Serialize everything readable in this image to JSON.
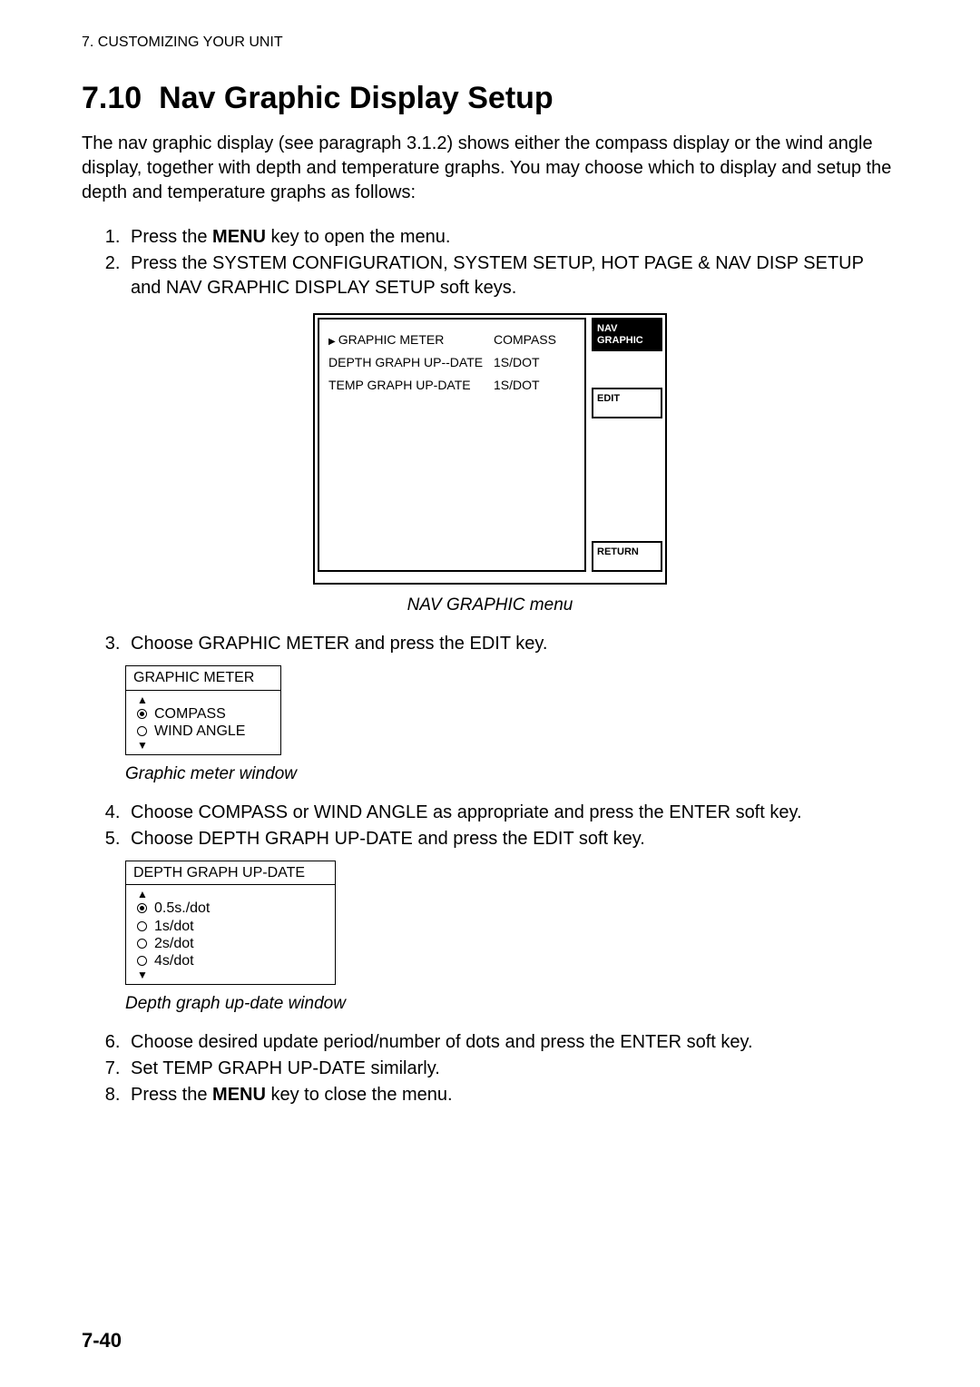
{
  "chapter_header": "7.  CUSTOMIZING YOUR UNIT",
  "section_number": "7.10",
  "section_title": "Nav Graphic Display Setup",
  "intro": "The nav graphic display (see paragraph 3.1.2) shows either the compass display or the wind angle display, together with depth and temperature graphs. You may choose which to display and setup the depth and temperature graphs as follows:",
  "steps1": {
    "s1_a": "Press the ",
    "s1_b": "MENU",
    "s1_c": " key to open the menu.",
    "s2": "Press the SYSTEM CONFIGURATION, SYSTEM SETUP, HOT PAGE & NAV DISP SETUP and NAV GRAPHIC DISPLAY SETUP soft keys."
  },
  "nav_menu": {
    "rows": [
      {
        "label": "GRAPHIC METER",
        "value": "COMPASS",
        "selected": true
      },
      {
        "label": "DEPTH GRAPH UP--DATE",
        "value": "1S/DOT",
        "selected": false
      },
      {
        "label": "TEMP GRAPH UP-DATE",
        "value": "1S/DOT",
        "selected": false
      }
    ],
    "softkeys": {
      "title1": "NAV",
      "title2": "GRAPHIC",
      "edit": "EDIT",
      "return": "RETURN"
    },
    "caption": "NAV GRAPHIC menu"
  },
  "step3": "Choose GRAPHIC METER and press the EDIT key.",
  "graphic_meter_win": {
    "title": "GRAPHIC METER",
    "options": [
      {
        "label": "COMPASS",
        "selected": true
      },
      {
        "label": "WIND ANGLE",
        "selected": false
      }
    ],
    "caption": "Graphic meter window"
  },
  "step4": "Choose COMPASS or WIND ANGLE as appropriate and press the ENTER soft key.",
  "step5": "Choose DEPTH GRAPH UP-DATE and press the EDIT soft key.",
  "depth_win": {
    "title": "DEPTH GRAPH UP-DATE",
    "options": [
      {
        "label": "0.5s./dot",
        "selected": true
      },
      {
        "label": "1s/dot",
        "selected": false
      },
      {
        "label": "2s/dot",
        "selected": false
      },
      {
        "label": "4s/dot",
        "selected": false
      }
    ],
    "caption": "Depth graph up-date window"
  },
  "step6": "Choose desired update period/number of dots and press the ENTER soft key.",
  "step7": "Set TEMP GRAPH UP-DATE similarly.",
  "step8_a": "Press the ",
  "step8_b": "MENU",
  "step8_c": " key to close the menu.",
  "page_number": "7-40"
}
